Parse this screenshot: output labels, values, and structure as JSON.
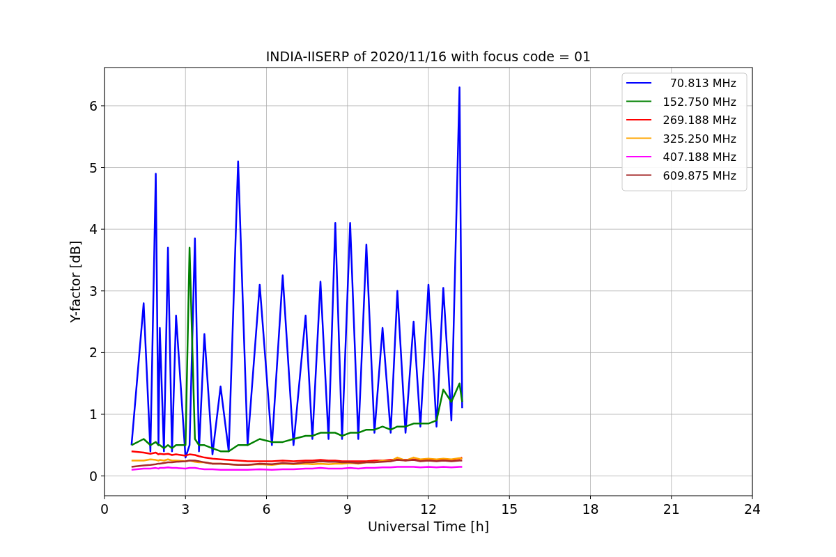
{
  "chart_data": {
    "type": "line",
    "title": "INDIA-IISERP of 2020/11/16 with focus code = 01",
    "xlabel": "Universal Time [h]",
    "ylabel": "Y-factor [dB]",
    "x": [
      1.0,
      1.45,
      1.7,
      1.9,
      2.0,
      2.05,
      2.2,
      2.35,
      2.5,
      2.65,
      3.0,
      3.15,
      3.35,
      3.5,
      3.7,
      4.0,
      4.3,
      4.6,
      4.95,
      5.3,
      5.75,
      6.2,
      6.6,
      7.0,
      7.45,
      7.7,
      8.0,
      8.3,
      8.55,
      8.8,
      9.1,
      9.4,
      9.7,
      10.0,
      10.3,
      10.6,
      10.85,
      11.15,
      11.45,
      11.7,
      12.0,
      12.3,
      12.55,
      12.85,
      13.15,
      13.25
    ],
    "series": [
      {
        "name": "70.813 MHz",
        "color": "#0000ff",
        "values": [
          0.5,
          2.8,
          0.4,
          4.9,
          0.5,
          2.4,
          0.4,
          3.7,
          0.4,
          2.6,
          0.3,
          0.5,
          3.85,
          0.4,
          2.3,
          0.35,
          1.45,
          0.4,
          5.1,
          0.5,
          3.1,
          0.5,
          3.25,
          0.5,
          2.6,
          0.6,
          3.15,
          0.6,
          4.1,
          0.6,
          4.1,
          0.6,
          3.75,
          0.7,
          2.4,
          0.7,
          3.0,
          0.7,
          2.5,
          0.8,
          3.1,
          0.8,
          3.05,
          0.9,
          6.3,
          1.1
        ]
      },
      {
        "name": "152.750 MHz",
        "color": "#008000",
        "values": [
          0.5,
          0.6,
          0.5,
          0.55,
          0.5,
          0.5,
          0.45,
          0.5,
          0.45,
          0.5,
          0.5,
          3.7,
          0.6,
          0.5,
          0.5,
          0.45,
          0.4,
          0.4,
          0.5,
          0.5,
          0.6,
          0.55,
          0.55,
          0.6,
          0.65,
          0.65,
          0.7,
          0.7,
          0.7,
          0.65,
          0.7,
          0.7,
          0.75,
          0.75,
          0.8,
          0.75,
          0.8,
          0.8,
          0.85,
          0.85,
          0.85,
          0.9,
          1.4,
          1.2,
          1.5,
          1.2
        ]
      },
      {
        "name": "269.188 MHz",
        "color": "#ff0000",
        "values": [
          0.4,
          0.38,
          0.36,
          0.38,
          0.35,
          0.36,
          0.35,
          0.36,
          0.34,
          0.35,
          0.33,
          0.35,
          0.34,
          0.32,
          0.3,
          0.28,
          0.27,
          0.26,
          0.25,
          0.24,
          0.24,
          0.24,
          0.25,
          0.24,
          0.25,
          0.25,
          0.26,
          0.25,
          0.25,
          0.24,
          0.24,
          0.24,
          0.24,
          0.25,
          0.25,
          0.26,
          0.27,
          0.26,
          0.27,
          0.26,
          0.27,
          0.26,
          0.27,
          0.26,
          0.28,
          0.3
        ]
      },
      {
        "name": "325.250 MHz",
        "color": "#ffa500",
        "values": [
          0.25,
          0.25,
          0.27,
          0.26,
          0.25,
          0.26,
          0.25,
          0.27,
          0.25,
          0.25,
          0.24,
          0.25,
          0.23,
          0.22,
          0.22,
          0.2,
          0.2,
          0.19,
          0.18,
          0.18,
          0.19,
          0.18,
          0.2,
          0.19,
          0.2,
          0.19,
          0.2,
          0.19,
          0.2,
          0.2,
          0.21,
          0.2,
          0.22,
          0.22,
          0.25,
          0.24,
          0.3,
          0.25,
          0.3,
          0.27,
          0.28,
          0.27,
          0.28,
          0.27,
          0.29,
          0.28
        ]
      },
      {
        "name": "407.188 MHz",
        "color": "#ff00ff",
        "values": [
          0.1,
          0.12,
          0.12,
          0.13,
          0.12,
          0.13,
          0.13,
          0.14,
          0.13,
          0.13,
          0.12,
          0.13,
          0.13,
          0.12,
          0.11,
          0.11,
          0.1,
          0.1,
          0.1,
          0.1,
          0.11,
          0.1,
          0.11,
          0.11,
          0.12,
          0.12,
          0.13,
          0.12,
          0.12,
          0.12,
          0.13,
          0.12,
          0.13,
          0.13,
          0.14,
          0.14,
          0.15,
          0.15,
          0.15,
          0.14,
          0.15,
          0.14,
          0.15,
          0.14,
          0.15,
          0.15
        ]
      },
      {
        "name": "609.875 MHz",
        "color": "#a52a2a",
        "values": [
          0.15,
          0.17,
          0.18,
          0.19,
          0.2,
          0.2,
          0.21,
          0.22,
          0.22,
          0.23,
          0.24,
          0.25,
          0.25,
          0.24,
          0.22,
          0.2,
          0.2,
          0.19,
          0.18,
          0.18,
          0.2,
          0.19,
          0.21,
          0.2,
          0.22,
          0.22,
          0.24,
          0.23,
          0.23,
          0.22,
          0.22,
          0.21,
          0.22,
          0.22,
          0.23,
          0.24,
          0.26,
          0.25,
          0.26,
          0.24,
          0.25,
          0.24,
          0.25,
          0.24,
          0.25,
          0.25
        ]
      }
    ],
    "xlim": [
      0,
      24
    ],
    "ylim": [
      -0.32,
      6.62
    ],
    "xticks": [
      0,
      3,
      6,
      9,
      12,
      15,
      18,
      21,
      24
    ],
    "yticks": [
      0,
      1,
      2,
      3,
      4,
      5,
      6
    ],
    "grid": true,
    "legend": true
  }
}
